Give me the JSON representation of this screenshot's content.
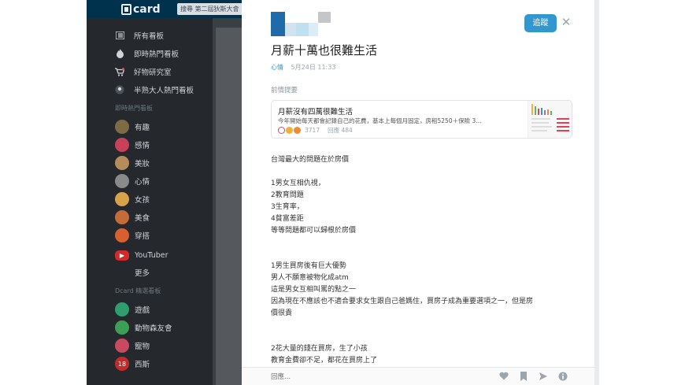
{
  "header": {
    "logo_text": "card",
    "search_text": "搜尋 第二屆狄斯大會"
  },
  "sidebar": {
    "main_items": [
      {
        "icon": "list-icon",
        "label": "所有看板"
      },
      {
        "icon": "fire-icon",
        "label": "即時熱門看板"
      },
      {
        "icon": "cart-icon",
        "label": "好物研究室"
      },
      {
        "icon": "community-icon",
        "label": "半熟大人熱門看板"
      }
    ],
    "hot_section_label": "即時熱門看板",
    "hot_boards": [
      {
        "label": "有趣",
        "color": "#7c6b44"
      },
      {
        "label": "感情",
        "color": "#c9405a"
      },
      {
        "label": "美妝",
        "color": "#b68d5a"
      },
      {
        "label": "心情",
        "color": "#8a8a8a"
      },
      {
        "label": "女孩",
        "color": "#d8a24a"
      },
      {
        "label": "美食",
        "color": "#c46b3a"
      },
      {
        "label": "穿搭",
        "color": "#d9602e"
      },
      {
        "label": "YouTuber",
        "color": "#d32a2a"
      }
    ],
    "more_label": "更多",
    "dcard_section_label": "Dcard 精選看板",
    "dcard_boards": [
      {
        "label": "遊戲",
        "color": "#2f9e6e"
      },
      {
        "label": "動物森友會",
        "color": "#3d9e58"
      },
      {
        "label": "寵物",
        "color": "#c94a5f"
      },
      {
        "label": "西斯",
        "color": "#c22b2b"
      }
    ]
  },
  "post": {
    "follow_label": "追蹤",
    "title": "月薪十萬也很難生活",
    "board": "心情",
    "date": "5月24日 11:33",
    "prev_label": "前情提要",
    "prev_card": {
      "title": "月薪沒有四萬很難生活",
      "excerpt": "今年開始每天都會記錄自己的花費，基本上每個月固定，房租5250＋保險 3...",
      "likes": "3717",
      "replies_label": "回應 484"
    },
    "content": [
      "台灣最大的問題在於房價",
      "",
      "1男女互相仇視，",
      "2教育問題",
      "3生育率，",
      "4貧富差距",
      "等等問題都可以歸根於房價",
      "",
      "",
      "1男生買房後有巨大優勢",
      "男人不願意被物化成atm",
      "這是男女互相叫罵的點之一",
      "因為現在不應該也不適合要求女生跟自己爸媽住，買房子成為重要選項之一，但是房",
      "價很貴",
      "",
      "",
      "2花大量的錢在買房，生了小孩",
      "教育金費卻不足，都花在買房上了"
    ],
    "reply_placeholder": "回應..."
  }
}
